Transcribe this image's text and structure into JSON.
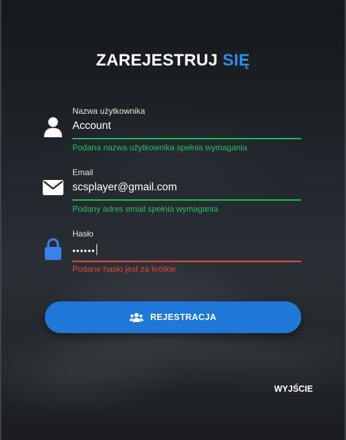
{
  "header": {
    "title_part1": "ZAREJESTRUJ",
    "title_part2": "SIĘ",
    "accent_color": "#2e8fe6"
  },
  "form": {
    "username": {
      "label": "Nazwa użytkownika",
      "value": "Account",
      "message": "Podana nazwa użytkownika spełnia wymagania",
      "status": "valid",
      "icon": "user-icon"
    },
    "email": {
      "label": "Email",
      "value": "scsplayer@gmail.com",
      "message": "Podany adres email spełnia wymagania",
      "status": "valid",
      "icon": "envelope-icon"
    },
    "password": {
      "label": "Hasło",
      "value": "••••••",
      "message": "Podane hasło jest za krótkie",
      "status": "invalid",
      "icon": "lock-icon"
    }
  },
  "buttons": {
    "register_label": "REJESTRACJA",
    "register_icon": "users-icon",
    "exit_label": "WYJŚCIE"
  },
  "colors": {
    "valid": "#1fbf4f",
    "invalid": "#e04a3c",
    "button": "#1f78d8",
    "lock_icon": "#3b82e8"
  }
}
